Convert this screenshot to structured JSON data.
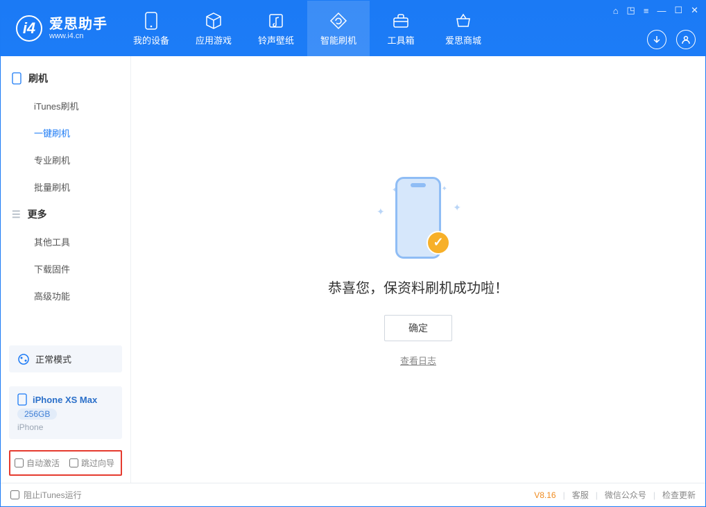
{
  "app": {
    "title": "爱思助手",
    "subtitle": "www.i4.cn"
  },
  "nav": {
    "items": [
      {
        "label": "我的设备"
      },
      {
        "label": "应用游戏"
      },
      {
        "label": "铃声壁纸"
      },
      {
        "label": "智能刷机"
      },
      {
        "label": "工具箱"
      },
      {
        "label": "爱思商城"
      }
    ]
  },
  "sidebar": {
    "section1": {
      "title": "刷机",
      "items": [
        "iTunes刷机",
        "一键刷机",
        "专业刷机",
        "批量刷机"
      ]
    },
    "section2": {
      "title": "更多",
      "items": [
        "其他工具",
        "下载固件",
        "高级功能"
      ]
    }
  },
  "mode": {
    "label": "正常模式"
  },
  "device": {
    "name": "iPhone XS Max",
    "capacity": "256GB",
    "type": "iPhone"
  },
  "options": {
    "auto_activate": "自动激活",
    "skip_guide": "跳过向导"
  },
  "main": {
    "success_msg": "恭喜您，保资料刷机成功啦！",
    "ok_label": "确定",
    "view_log": "查看日志"
  },
  "footer": {
    "block_itunes": "阻止iTunes运行",
    "version": "V8.16",
    "links": [
      "客服",
      "微信公众号",
      "检查更新"
    ]
  }
}
